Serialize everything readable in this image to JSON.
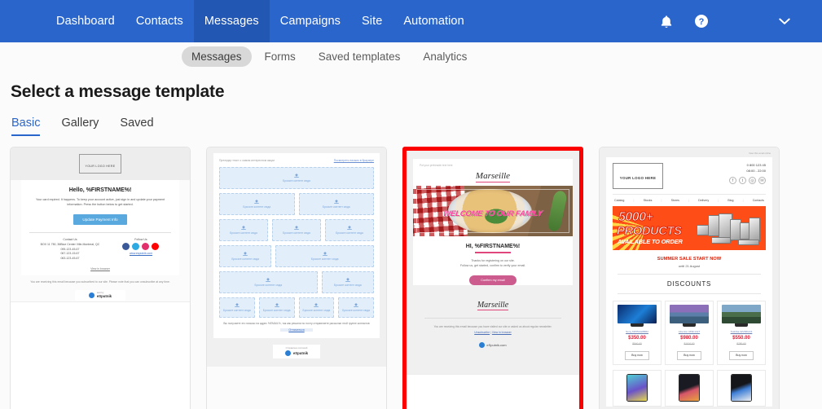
{
  "topnav": {
    "items": [
      {
        "label": "Dashboard",
        "active": false
      },
      {
        "label": "Contacts",
        "active": false
      },
      {
        "label": "Messages",
        "active": true
      },
      {
        "label": "Campaigns",
        "active": false
      },
      {
        "label": "Site",
        "active": false
      },
      {
        "label": "Automation",
        "active": false
      }
    ],
    "icons": {
      "notifications": "bell-icon",
      "help": "help-circle-icon",
      "account_menu": "chevron-down-icon"
    },
    "bg_color": "#2a65cc",
    "active_bg_color": "#2357b4"
  },
  "subnav": {
    "items": [
      {
        "label": "Messages",
        "active": true
      },
      {
        "label": "Forms",
        "active": false
      },
      {
        "label": "Saved templates",
        "active": false
      },
      {
        "label": "Analytics",
        "active": false
      }
    ]
  },
  "page": {
    "title": "Select a message template",
    "tabs": [
      {
        "label": "Basic",
        "active": true
      },
      {
        "label": "Gallery",
        "active": false
      },
      {
        "label": "Saved",
        "active": false
      }
    ],
    "accent_color": "#2a65cc",
    "selection_color": "#fc0000"
  },
  "templates": [
    {
      "name": "card-payment-reminder",
      "selected": false,
      "logo_placeholder": "YOUR LOGO HERE",
      "heading": "Hello, %FIRSTNAME%!",
      "body": "Your card expired. It happens. To keep your account active, just sign in and update your payment information. Press the button below to get started.",
      "button": "Update Payment Info",
      "contact_label": "Contact Us",
      "address": "BOX 11 750, 36Blue Center Ville-Montreal, QC",
      "phones": [
        "095-123-45-67",
        "067-123-15-67",
        "063-123-45-67"
      ],
      "follow_label": "Follow Us",
      "site_link": "www.esputnik.com",
      "view_in_browser": "View in browser",
      "footer": "You are receiving this email because you subscribed to our site. Please note that you can unsubscribe at any time.",
      "footer_link": "unsubscribe",
      "badge_small": "sent by",
      "badge_name": "eSputnik",
      "socials": [
        "facebook-icon",
        "twitter-icon",
        "instagram-icon",
        "youtube-icon"
      ]
    },
    {
      "name": "card-blank-blocks",
      "selected": false,
      "preheader": "Прехедер текст о самом интересном акции",
      "view_link": "Посмотреть письмо в браузере",
      "drop_label": "Бросьте контент сюда",
      "rows": [
        [
          1
        ],
        [
          1,
          1
        ],
        [
          1,
          1,
          1
        ],
        [
          1,
          2
        ],
        [
          2,
          1
        ],
        [
          1,
          1,
          1,
          1
        ]
      ],
      "footer": "Вы получаете это письмо на адрес %EMAIL%, так как решили по почту отправляете рассылки этой группе контактов",
      "unsubscribe": "Отписаться",
      "badge_small": "Отправлено системой",
      "badge_name": "eSputnik"
    },
    {
      "name": "card-marseille-welcome",
      "selected": true,
      "preheader": "Put your preheader text here",
      "brand": "Marseille",
      "hero_text": "WELCOME TO OUR FAMILY",
      "heading": "HI, %FIRSTNAME%!",
      "body_line1": "Thanks for registering on our site.",
      "body_line2": "Follow us, get started, confirm to verify your email.",
      "button": "Confirm my email",
      "brand_footer": "Marseille",
      "footer": "You are receiving this email because you have visited our site or asked us about regular newsletter.",
      "link_unsubscribe": "Unsubscribe",
      "link_view": "View in browser",
      "badge_small": "sent by",
      "badge_name": "eSputnik.com"
    },
    {
      "name": "card-products-sale",
      "selected": false,
      "view_online": "View this email online",
      "logo_placeholder": "YOUR LOGO HERE",
      "phone": "0 800 123 45",
      "hours": "08:00 - 22:00",
      "socials": [
        "facebook-icon",
        "twitter-icon",
        "instagram-icon",
        "mail-icon"
      ],
      "menu": [
        "Catalog",
        "Stocks",
        "Stores",
        "Delivery",
        "Blog",
        "Contacts"
      ],
      "banner_line1": "5000+",
      "banner_line2": "PRODUCTS",
      "banner_line3": "AVAILABLE TO ORDER",
      "sale_title": "SUMMER SALE START NOW",
      "sale_until": "until 21 August",
      "discounts_title": "DISCOUNTS",
      "products_row1": [
        {
          "name": "Sony KD55AG8BR2",
          "price": "$350.00",
          "old_price": "$540.00",
          "buy": "Buy now",
          "screen": "tv-blue"
        },
        {
          "name": "Liberton 43SF13LT",
          "price": "$980.00",
          "old_price": "$1100.00",
          "buy": "Buy now",
          "screen": "tv-city"
        },
        {
          "name": "Toshiba 32V38GX4",
          "price": "$550.00",
          "old_price": "$780.00",
          "buy": "Buy now",
          "screen": "tv-hills"
        }
      ],
      "products_row2": [
        {
          "screen": "phone-teal"
        },
        {
          "screen": "phone-dark"
        },
        {
          "screen": "phone-black"
        }
      ]
    }
  ]
}
